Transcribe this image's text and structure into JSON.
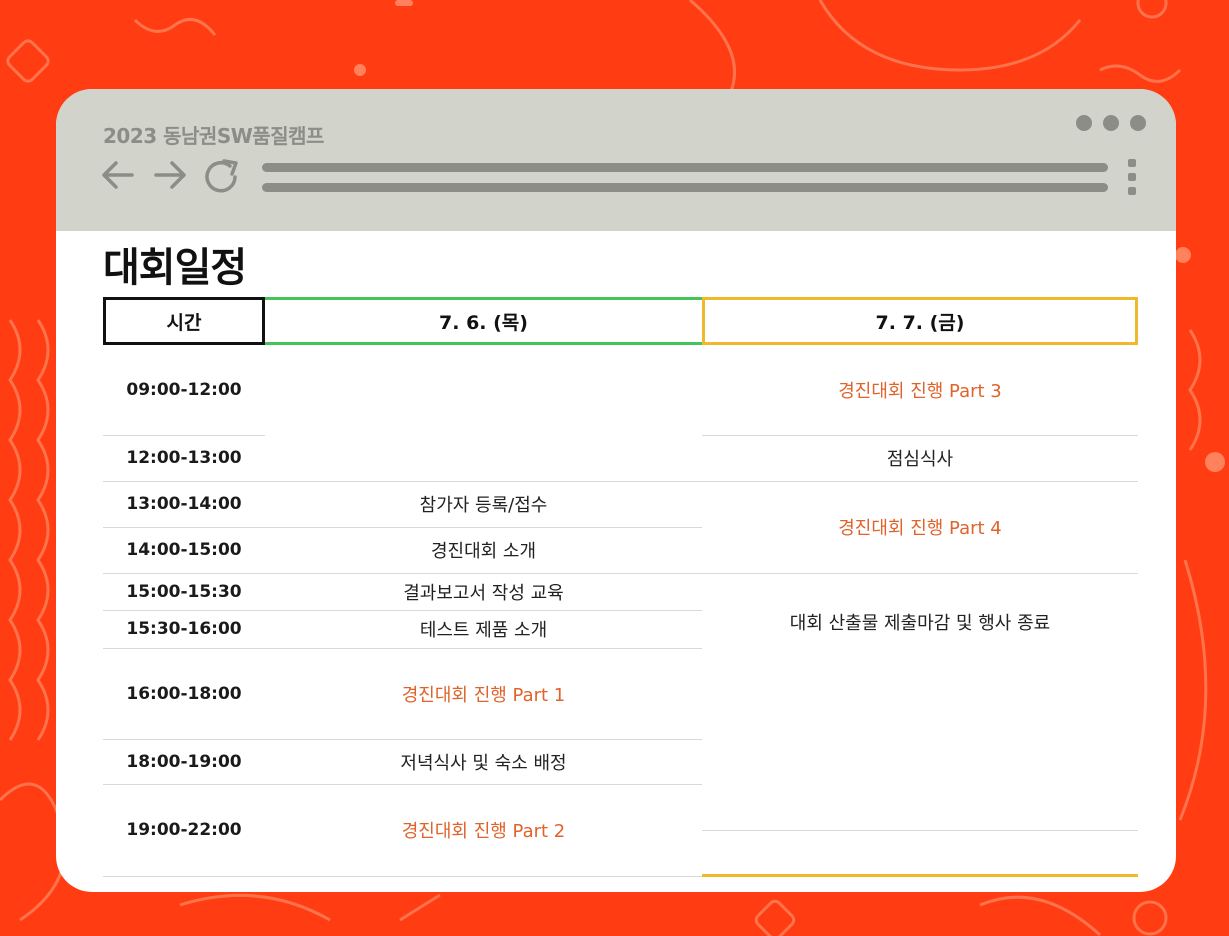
{
  "browser": {
    "title": "2023 동남권SW품질캠프"
  },
  "page": {
    "heading": "대회일정"
  },
  "schedule": {
    "headers": {
      "time": "시간",
      "day1": "7. 6. (목)",
      "day2": "7. 7. (금)"
    },
    "times": [
      "09:00-12:00",
      "12:00-13:00",
      "13:00-14:00",
      "14:00-15:00",
      "15:00-15:30",
      "15:30-16:00",
      "16:00-18:00",
      "18:00-19:00",
      "19:00-22:00"
    ],
    "day1": [
      "참가자 등록/접수",
      "경진대회 소개",
      "결과보고서 작성 교육",
      "테스트 제품 소개",
      "경진대회 진행 Part 1",
      "저녁식사 및 숙소 배정",
      "경진대회 진행 Part 2"
    ],
    "day2": [
      "경진대회 진행 Part 3",
      "점심식사",
      "경진대회 진행 Part 4",
      "대회 산출물 제출마감 및 행사 종료"
    ]
  },
  "colors": {
    "background": "#ff3c12",
    "chrome": "#d2d3cb",
    "highlight": "#e0632b",
    "day1_accent": "#46c35a",
    "day2_accent": "#f0b92c"
  }
}
